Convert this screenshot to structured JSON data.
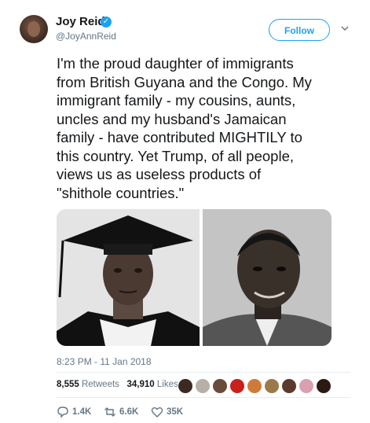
{
  "author": {
    "name": "Joy Reid",
    "handle": "@JoyAnnReid",
    "verified_mark": "✓"
  },
  "follow_label": "Follow",
  "tweet": {
    "text": "I'm the proud daughter of immigrants\nfrom British Guyana and the Congo. My\nimmigrant family - my cousins, aunts,\nuncles and my husband's Jamaican\nfamily - have contributed MIGHTILY to\nthis country. Yet Trump, of all people,\nviews us as useless products of\n\"shithole countries.\"",
    "timestamp": "8:23 PM - 11 Jan 2018"
  },
  "stats": {
    "retweets_count": "8,555",
    "retweets_label": "Retweets",
    "likes_count": "34,910",
    "likes_label": "Likes"
  },
  "actions": {
    "replies": "1.4K",
    "retweets": "6.6K",
    "likes": "35K"
  },
  "colors": {
    "accent": "#1da1f2",
    "secondary_text": "#657786",
    "divider": "#e6ecf0"
  },
  "icons": [
    "verified-badge-icon",
    "chevron-down-icon",
    "reply-icon",
    "retweet-icon",
    "heart-icon"
  ]
}
